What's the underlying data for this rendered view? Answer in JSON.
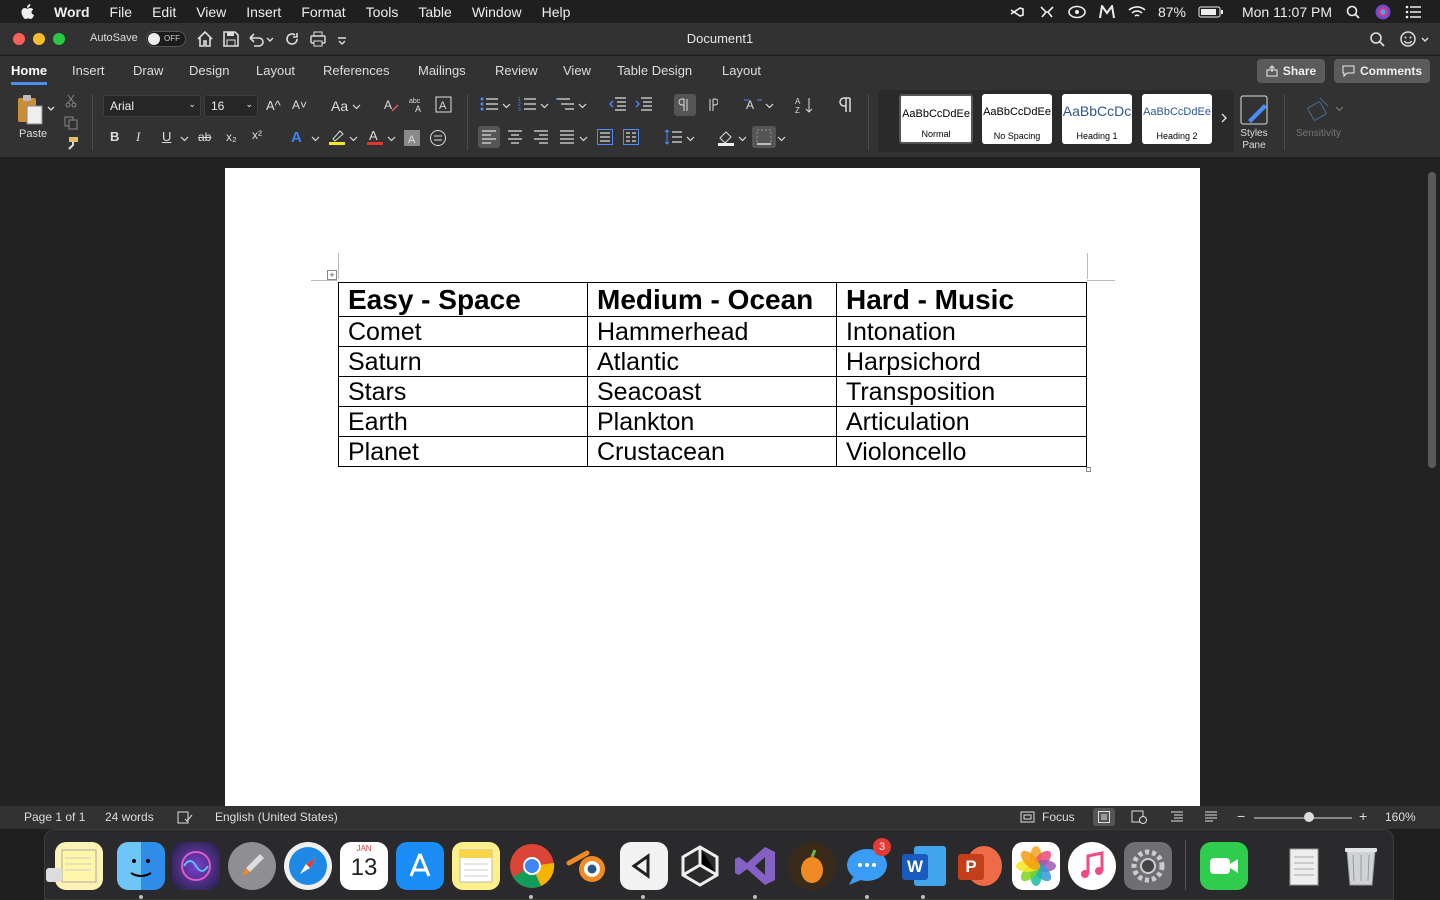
{
  "menubar": {
    "app": "Word",
    "items": [
      "File",
      "Edit",
      "View",
      "Insert",
      "Format",
      "Tools",
      "Table",
      "Window",
      "Help"
    ],
    "battery": "87%",
    "clock": "Mon 11:07 PM"
  },
  "titlebar": {
    "autosave_label": "AutoSave",
    "autosave_state": "OFF",
    "document_title": "Document1"
  },
  "tabs": [
    "Home",
    "Insert",
    "Draw",
    "Design",
    "Layout",
    "References",
    "Mailings",
    "Review",
    "View",
    "Table Design",
    "Layout"
  ],
  "tabs_right": {
    "share": "Share",
    "comments": "Comments"
  },
  "ribbon": {
    "paste": "Paste",
    "font": "Arial",
    "size": "16",
    "grow": "A^",
    "shrink": "A˅",
    "change_case": "Aa",
    "bold": "B",
    "italic": "I",
    "underline": "U",
    "strike": "ab",
    "subscript": "x₂",
    "superscript": "x²",
    "styles": [
      {
        "preview": "AaBbCcDdEe",
        "name": "Normal"
      },
      {
        "preview": "AaBbCcDdEe",
        "name": "No Spacing"
      },
      {
        "preview": "AaBbCcDc",
        "name": "Heading 1"
      },
      {
        "preview": "AaBbCcDdEe",
        "name": "Heading 2"
      }
    ],
    "styles_pane": "Styles\nPane",
    "sensitivity": "Sensitivity"
  },
  "table": {
    "headers": [
      "Easy - Space",
      "Medium - Ocean",
      "Hard - Music"
    ],
    "rows": [
      [
        "Comet",
        "Hammerhead",
        "Intonation"
      ],
      [
        "Saturn",
        "Atlantic",
        "Harpsichord"
      ],
      [
        "Stars",
        "Seacoast",
        "Transposition"
      ],
      [
        "Earth",
        "Plankton",
        "Articulation"
      ],
      [
        "Planet",
        "Crustacean",
        "Violoncello"
      ]
    ]
  },
  "statusbar": {
    "page": "Page 1 of 1",
    "words": "24 words",
    "language": "English (United States)",
    "focus": "Focus",
    "zoom": "160%"
  },
  "dock": {
    "calendar_month": "JAN",
    "calendar_day": "13",
    "messages_badge": "3",
    "word_letter": "W",
    "powerpoint_letter": "P"
  }
}
